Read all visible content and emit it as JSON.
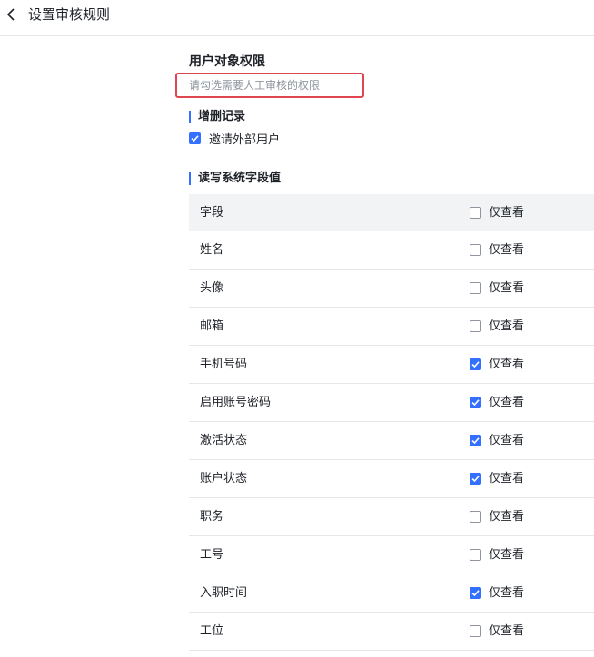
{
  "header": {
    "title": "设置审核规则"
  },
  "section": {
    "title": "用户对象权限",
    "hint": "请勾选需要人工审核的权限"
  },
  "group_add_delete": {
    "label": "增删记录",
    "option": {
      "label": "邀请外部用户",
      "checked": true
    }
  },
  "group_fields": {
    "label": "读写系统字段值",
    "header": {
      "name": "字段",
      "option": "仅查看",
      "checked": false
    },
    "rows": [
      {
        "name": "姓名",
        "option": "仅查看",
        "checked": false
      },
      {
        "name": "头像",
        "option": "仅查看",
        "checked": false
      },
      {
        "name": "邮箱",
        "option": "仅查看",
        "checked": false
      },
      {
        "name": "手机号码",
        "option": "仅查看",
        "checked": true
      },
      {
        "name": "启用账号密码",
        "option": "仅查看",
        "checked": true
      },
      {
        "name": "激活状态",
        "option": "仅查看",
        "checked": true
      },
      {
        "name": "账户状态",
        "option": "仅查看",
        "checked": true
      },
      {
        "name": "职务",
        "option": "仅查看",
        "checked": false
      },
      {
        "name": "工号",
        "option": "仅查看",
        "checked": false
      },
      {
        "name": "入职时间",
        "option": "仅查看",
        "checked": true
      },
      {
        "name": "工位",
        "option": "仅查看",
        "checked": false
      }
    ]
  },
  "colors": {
    "accent": "#3370ff",
    "highlight_border": "#e0464f"
  }
}
